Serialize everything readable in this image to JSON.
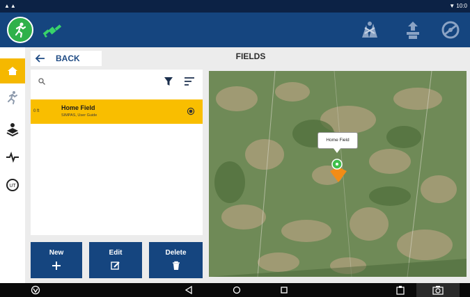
{
  "status_bar": {
    "left_icons": "▲▲",
    "time": "10:0"
  },
  "header": {
    "logo_icon": "runner-icon",
    "gps_icon": "satellite-icon",
    "right_icons": [
      "field-map-icon",
      "guidance-icon",
      "steering-wheel-icon"
    ]
  },
  "rail": {
    "items": [
      {
        "name": "home",
        "icon": "home-icon",
        "active": true
      },
      {
        "name": "run",
        "icon": "runner-icon",
        "active": false
      },
      {
        "name": "layers",
        "icon": "layers-icon",
        "active": false
      },
      {
        "name": "diagnostics",
        "icon": "pulse-icon",
        "active": false
      },
      {
        "name": "units",
        "icon": "units-icon",
        "label": "UT",
        "active": false
      }
    ]
  },
  "toolbar": {
    "back_label": "BACK"
  },
  "page": {
    "title": "FIELDS"
  },
  "list": {
    "search_placeholder": "",
    "items": [
      {
        "distance": "0 ft",
        "name": "Home Field",
        "subtitle": "SIMPAS, User Guide",
        "selected": true
      }
    ]
  },
  "actions": {
    "new_label": "New",
    "edit_label": "Edit",
    "delete_label": "Delete"
  },
  "map": {
    "marker_label": "Home Field"
  },
  "colors": {
    "header": "#15457f",
    "accent": "#f9be00",
    "brand_green": "#2fb14a"
  }
}
